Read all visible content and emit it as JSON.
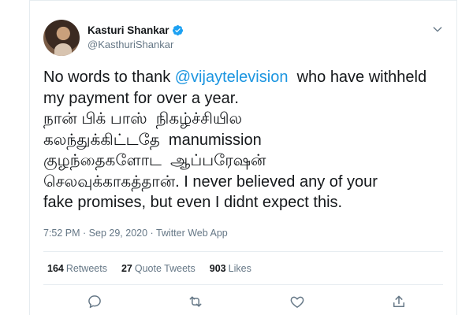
{
  "tweet": {
    "author": {
      "display_name": "Kasturi Shankar",
      "handle": "@KasthuriShankar",
      "verified": true
    },
    "text": {
      "line1_before": "No words to thank ",
      "mention": "@vijaytelevision",
      "line1_after": "  who have withheld",
      "rest": "my payment for over a year.\nநான் பிக் பாஸ்  நிகழ்ச்சியில\nகலந்துக்கிட்டதே  manumission\nகுழந்தைகளோட  ஆப்பரேஷன்\nசெலவுக்காகத்தான். I never believed any of your\nfake promises, but even I didnt expect this."
    },
    "meta": {
      "time": "7:52 PM",
      "separator1": " · ",
      "date": "Sep 29, 2020",
      "separator2": " · ",
      "app": "Twitter Web App"
    },
    "stats": {
      "retweets_count": "164",
      "retweets_label": "Retweets",
      "quote_count": "27",
      "quote_label": "Quote Tweets",
      "likes_count": "903",
      "likes_label": "Likes"
    },
    "icons": {
      "verified": "verified-badge-icon",
      "more": "chevron-down-icon",
      "reply": "reply-icon",
      "retweet": "retweet-icon",
      "like": "heart-icon",
      "share": "share-icon"
    },
    "colors": {
      "accent": "#1da1f2",
      "mention": "#1b95e0",
      "text": "#14171a",
      "muted": "#657786",
      "border": "#e6ecf0"
    }
  }
}
